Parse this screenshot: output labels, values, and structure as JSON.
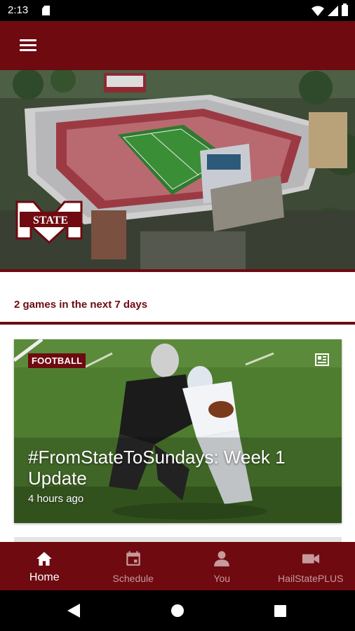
{
  "status_bar": {
    "time": "2:13"
  },
  "header": {
    "menu_icon": "hamburger-menu-icon"
  },
  "hero": {
    "logo_text": "STATE",
    "logo_letter": "M"
  },
  "games_banner": {
    "text": "2 games in the next 7 days"
  },
  "news": [
    {
      "category": "FOOTBALL",
      "title": "#FromStateToSundays: Week 1 Update",
      "time": "4 hours ago",
      "icon": "article-icon"
    }
  ],
  "bottom_nav": {
    "items": [
      {
        "label": "Home",
        "icon": "home-icon",
        "active": true
      },
      {
        "label": "Schedule",
        "icon": "calendar-icon",
        "active": false
      },
      {
        "label": "You",
        "icon": "person-icon",
        "active": false
      },
      {
        "label": "HailStatePLUS",
        "icon": "video-camera-icon",
        "active": false
      }
    ]
  },
  "colors": {
    "maroon": "#6e0a10",
    "inactive_nav": "#c79a9c",
    "field_green": "#4a7a2a"
  }
}
